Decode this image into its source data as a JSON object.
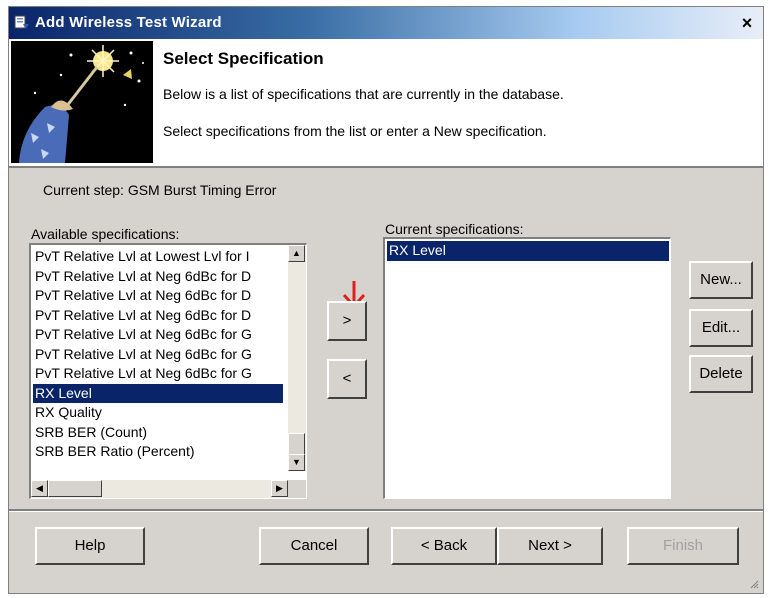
{
  "window": {
    "title": "Add Wireless Test Wizard",
    "close_glyph": "×"
  },
  "header": {
    "title": "Select Specification",
    "line1": "Below is a list of specifications that are currently in the database.",
    "line2": "Select specifications from the list or enter a New specification."
  },
  "step": {
    "label": "Current step: GSM Burst Timing Error"
  },
  "available": {
    "label": "Available specifications:",
    "items": [
      {
        "text": "PvT Relative Lvl at Lowest Lvl for I",
        "selected": false
      },
      {
        "text": "PvT Relative Lvl at Neg 6dBc for D",
        "selected": false
      },
      {
        "text": "PvT Relative Lvl at Neg 6dBc for D",
        "selected": false
      },
      {
        "text": "PvT Relative Lvl at Neg 6dBc for D",
        "selected": false
      },
      {
        "text": "PvT Relative Lvl at Neg 6dBc for G",
        "selected": false
      },
      {
        "text": "PvT Relative Lvl at Neg 6dBc for G",
        "selected": false
      },
      {
        "text": "PvT Relative Lvl at Neg 6dBc for G",
        "selected": false
      },
      {
        "text": "RX Level",
        "selected": true
      },
      {
        "text": "RX Quality",
        "selected": false
      },
      {
        "text": "SRB BER (Count)",
        "selected": false
      },
      {
        "text": "SRB BER Ratio (Percent)",
        "selected": false
      }
    ],
    "scroll_up_glyph": "▲",
    "scroll_down_glyph": "▼",
    "scroll_left_glyph": "◀",
    "scroll_right_glyph": "▶"
  },
  "current": {
    "label": "Current specifications:",
    "items": [
      {
        "text": "RX Level",
        "selected": true
      }
    ]
  },
  "transfer": {
    "add_label": ">",
    "remove_label": "<"
  },
  "side_buttons": {
    "new_label": "New...",
    "edit_label": "Edit...",
    "delete_label": "Delete"
  },
  "footer": {
    "help_label": "Help",
    "cancel_label": "Cancel",
    "back_label": "< Back",
    "next_label": "Next >",
    "finish_label": "Finish"
  },
  "icons": {
    "title_icon": "wizard-app-icon",
    "banner": "wizard-banner-image",
    "arrow": "red-down-arrow-icon"
  },
  "colors": {
    "selection": "#0a246a",
    "arrow": "#e0201c"
  }
}
